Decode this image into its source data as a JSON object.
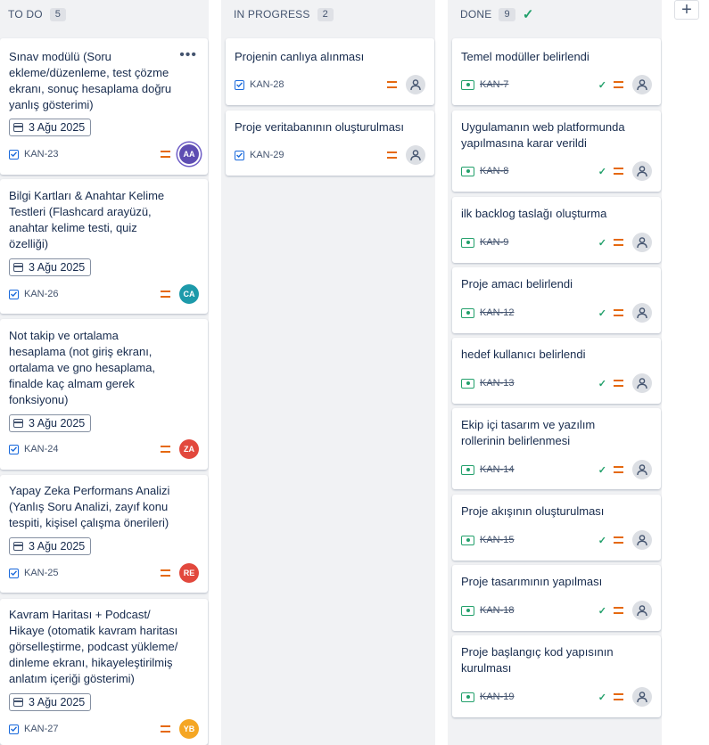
{
  "columns": [
    {
      "title": "TO DO",
      "count": "5"
    },
    {
      "title": "IN PROGRESS",
      "count": "2"
    },
    {
      "title": "DONE",
      "count": "9"
    }
  ],
  "todo": [
    {
      "title": "Sınav modülü (Soru\nekleme/düzenleme, test çözme\nekranı, sonuç hesaplama doğru\nyanlış gösterimi)",
      "date": "3 Ağu 2025",
      "key": "KAN-23",
      "avatar": "AA",
      "avatar_color": "#5e4db2"
    },
    {
      "title": "Bilgi Kartları & Anahtar Kelime\nTestleri (Flashcard arayüzü,\nanahtar kelime testi, quiz\nözelliği)",
      "date": "3 Ağu 2025",
      "key": "KAN-26",
      "avatar": "CA",
      "avatar_color": "#1d9aaa"
    },
    {
      "title": "Not takip ve ortalama\nhesaplama (not giriş ekranı,\nortalama ve gno hesaplama,\nfinalde kaç almam gerek\nfonksiyonu)",
      "date": "3 Ağu 2025",
      "key": "KAN-24",
      "avatar": "ZA",
      "avatar_color": "#e2483d"
    },
    {
      "title": "Yapay Zeka Performans Analizi\n(Yanlış Soru Analizi, zayıf konu\ntespiti, kişisel çalışma önerileri)",
      "date": "3 Ağu 2025",
      "key": "KAN-25",
      "avatar": "RE",
      "avatar_color": "#e2483d"
    },
    {
      "title": "Kavram Haritası + Podcast/\nHikaye (otomatik kavram haritası\ngörselleştirme, podcast yükleme/\ndinleme ekranı, hikayeleştirilmiş\nanlatım içeriği gösterimi)",
      "date": "3 Ağu 2025",
      "key": "KAN-27",
      "avatar": "YB",
      "avatar_color": "#f5a623"
    }
  ],
  "in_progress": [
    {
      "title": "Projenin canlıya alınması",
      "key": "KAN-28"
    },
    {
      "title": "Proje veritabanının oluşturulması",
      "key": "KAN-29"
    }
  ],
  "done": [
    {
      "title": "Temel modüller belirlendi",
      "key": "KAN-7"
    },
    {
      "title": "Uygulamanın web platformunda\nyapılmasına karar verildi",
      "key": "KAN-8"
    },
    {
      "title": "ilk backlog taslağı oluşturma",
      "key": "KAN-9"
    },
    {
      "title": "Proje amacı belirlendi",
      "key": "KAN-12"
    },
    {
      "title": "hedef kullanıcı belirlendi",
      "key": "KAN-13"
    },
    {
      "title": "Ekip içi tasarım ve yazılım\nrollerinin belirlenmesi",
      "key": "KAN-14"
    },
    {
      "title": "Proje akışının oluşturulması",
      "key": "KAN-15"
    },
    {
      "title": "Proje tasarımının yapılması",
      "key": "KAN-18"
    },
    {
      "title": "Proje başlangıç kod yapısının\nkurulması",
      "key": "KAN-19"
    }
  ],
  "icons": {
    "more": "more-icon",
    "plus": "plus-icon"
  }
}
